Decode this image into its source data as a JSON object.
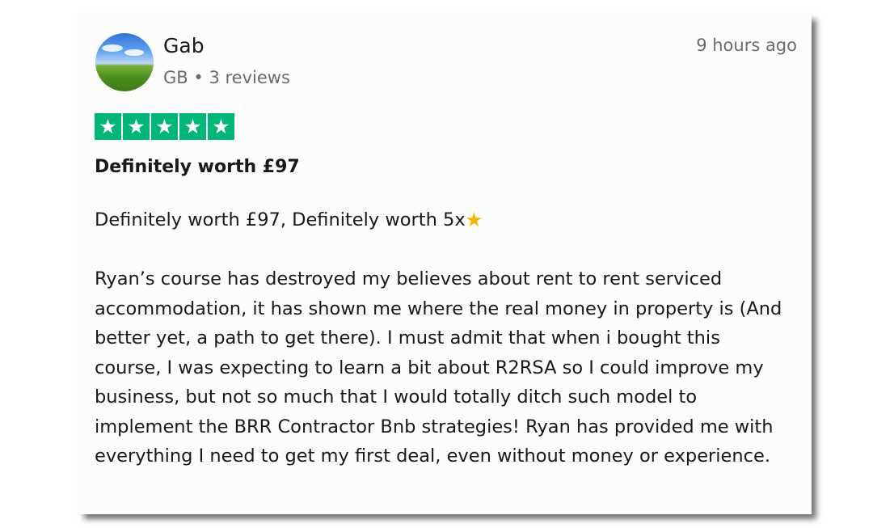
{
  "reviewer": {
    "name": "Gab",
    "country": "GB",
    "separator": "•",
    "reviews_count": "3 reviews",
    "time_ago": "9 hours ago"
  },
  "rating": {
    "stars": 5,
    "max_stars": 5,
    "star_color": "#00b67a",
    "star_glyph": "★"
  },
  "review": {
    "title": "Definitely worth £97",
    "line1": "Definitely worth £97, Definitely worth 5x",
    "line1_emoji": "star-emoji-icon",
    "paragraph": "Ryan’s course has destroyed my believes about rent to rent serviced accommodation, it has shown me where the real money in property is (And better yet, a path to get there). I must admit that when i bought this course, I was expecting to learn a bit about R2RSA so I could improve my business, but not so much that I would totally ditch such model to implement the BRR Contractor Bnb strategies! Ryan has provided me with everything I need to get my first deal, even without money or experience."
  }
}
